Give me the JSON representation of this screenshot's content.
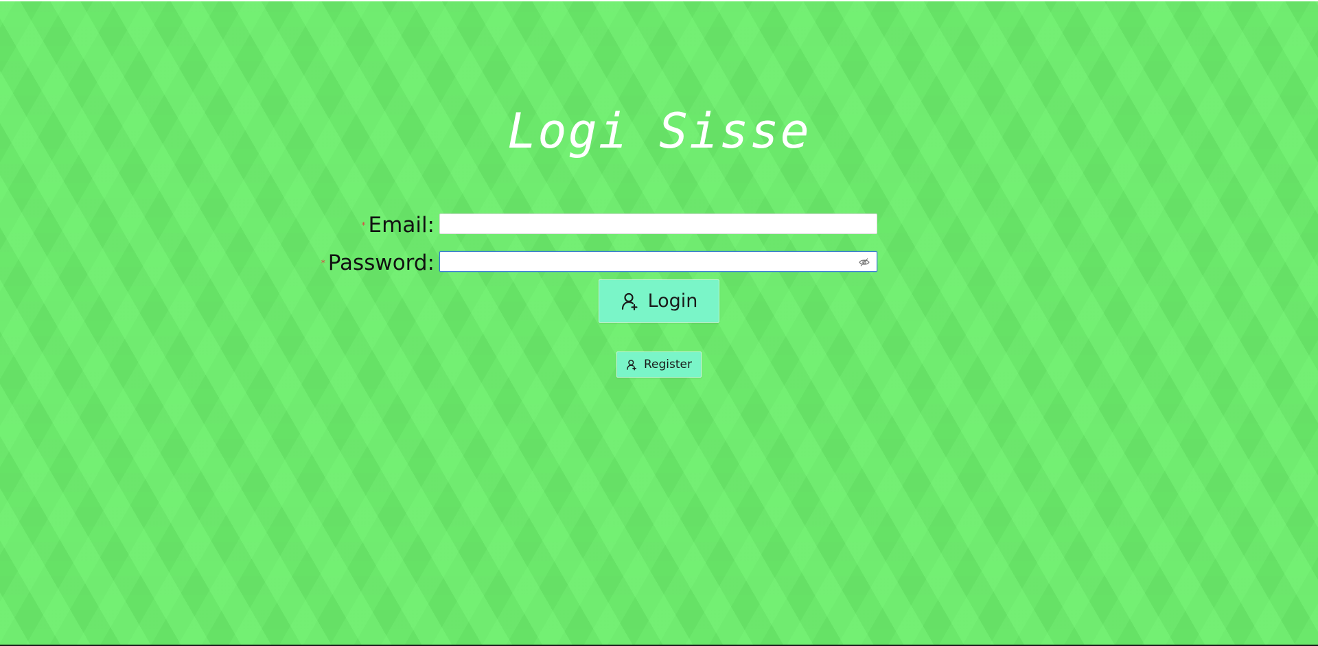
{
  "app": {
    "title": "Logi Sisse"
  },
  "form": {
    "email": {
      "label": "Email:",
      "value": "",
      "required": true
    },
    "password": {
      "label": "Password:",
      "value": "",
      "required": true,
      "visibility_icon": "eye-invisible-icon"
    },
    "required_marker": "*",
    "required_color": "#e04040"
  },
  "actions": {
    "login_label": "Login",
    "login_icon": "user-add-icon",
    "register_label": "Register",
    "register_icon": "user-add-icon"
  },
  "theme": {
    "background": "#66e066",
    "button_color": "#7af5c8",
    "focus_border": "#3a7bd5"
  }
}
